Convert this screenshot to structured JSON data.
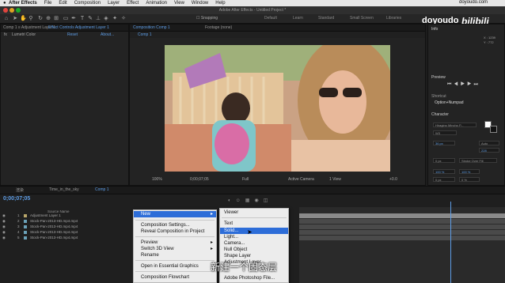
{
  "menubar": {
    "app": "After Effects",
    "items": [
      "File",
      "Edit",
      "Composition",
      "Layer",
      "Effect",
      "Animation",
      "View",
      "Window",
      "Help"
    ]
  },
  "titlebar": {
    "title": "Adobe After Effects - Untitled Project *"
  },
  "toolbar": {
    "snapping": "Snapping",
    "workspaces": [
      "Default",
      "Learn",
      "Standard",
      "Small Screen",
      "Libraries"
    ]
  },
  "project_panel": {
    "tabs": [
      "Comp 1 ≡ Adjustment Layer 1",
      "Effect Controls Adjustment Layer 1"
    ],
    "effect_row": {
      "fx": "fx",
      "name": "Lumetri Color",
      "reset": "Reset",
      "about": "About..."
    }
  },
  "composition_panel": {
    "tabs": [
      "Composition Comp 1",
      "Footage (none)"
    ],
    "subtab": "Comp 1",
    "footer": {
      "zoom": "100%",
      "timecode": "0;00;07;05",
      "quality": "Full",
      "camera": "Active Camera",
      "views": "1 View",
      "offset": "+0.0"
    }
  },
  "right_panel": {
    "info_title": "Info",
    "coords": {
      "x": "X : 1239",
      "y": "Y : 772"
    },
    "preview_title": "Preview",
    "shortcut_label": "Shortcut",
    "shortcut_value": "Option+Numpad",
    "character_title": "Character",
    "font": "Hiragino Mincho P...",
    "font_style": "W3",
    "size": "36 px",
    "leading": "Auto",
    "tracking": "228",
    "stroke": "Stroke Over Fill",
    "stroke_width": "0 px",
    "scale_v": "100 %",
    "scale_h": "100 %",
    "baseline": "0 px",
    "tsume": "0 %"
  },
  "timeline": {
    "tabs": [
      "渲染",
      "Time_in_the_sky",
      "Comp 1"
    ],
    "timecode": "0;00;07;05",
    "header": "Source Name",
    "layers": [
      {
        "num": "1",
        "name": "Adjustment Layer 1"
      },
      {
        "num": "2",
        "name": "Stock-Pan-2013-HD.mp4.mp4"
      },
      {
        "num": "3",
        "name": "Stock-Pan-2013-HD.mp4.mp4"
      },
      {
        "num": "4",
        "name": "Stock-Pan-2013-HD.mp4.mp4"
      },
      {
        "num": "5",
        "name": "Stock-Pan-2013-HD.mp4.mp4"
      }
    ]
  },
  "context_menu": {
    "items": [
      {
        "label": "New",
        "submenu": true,
        "highlight": true
      },
      {
        "label": "Composition Settings..."
      },
      {
        "label": "Reveal Composition in Project"
      },
      {
        "label": "Preview",
        "submenu": true
      },
      {
        "label": "Switch 3D View",
        "submenu": true
      },
      {
        "label": "Rename"
      },
      {
        "label": "Open in Essential Graphics"
      },
      {
        "label": "Composition Flowchart"
      }
    ]
  },
  "submenu": {
    "items": [
      {
        "label": "Viewer"
      },
      {
        "label": "Text"
      },
      {
        "label": "Solid...",
        "highlight": true
      },
      {
        "label": "Light..."
      },
      {
        "label": "Camera..."
      },
      {
        "label": "Null Object"
      },
      {
        "label": "Shape Layer"
      },
      {
        "label": "Adjustment Layer"
      },
      {
        "label": "Adobe Photoshop File..."
      }
    ]
  },
  "watermark": {
    "site": "doyoudo.com",
    "name": "doyoudo",
    "brand": "bilibili"
  },
  "subtitle": "新建一个固态层",
  "colors": {
    "accent": "#2d6dd8",
    "timecode": "#5e9ee8"
  }
}
